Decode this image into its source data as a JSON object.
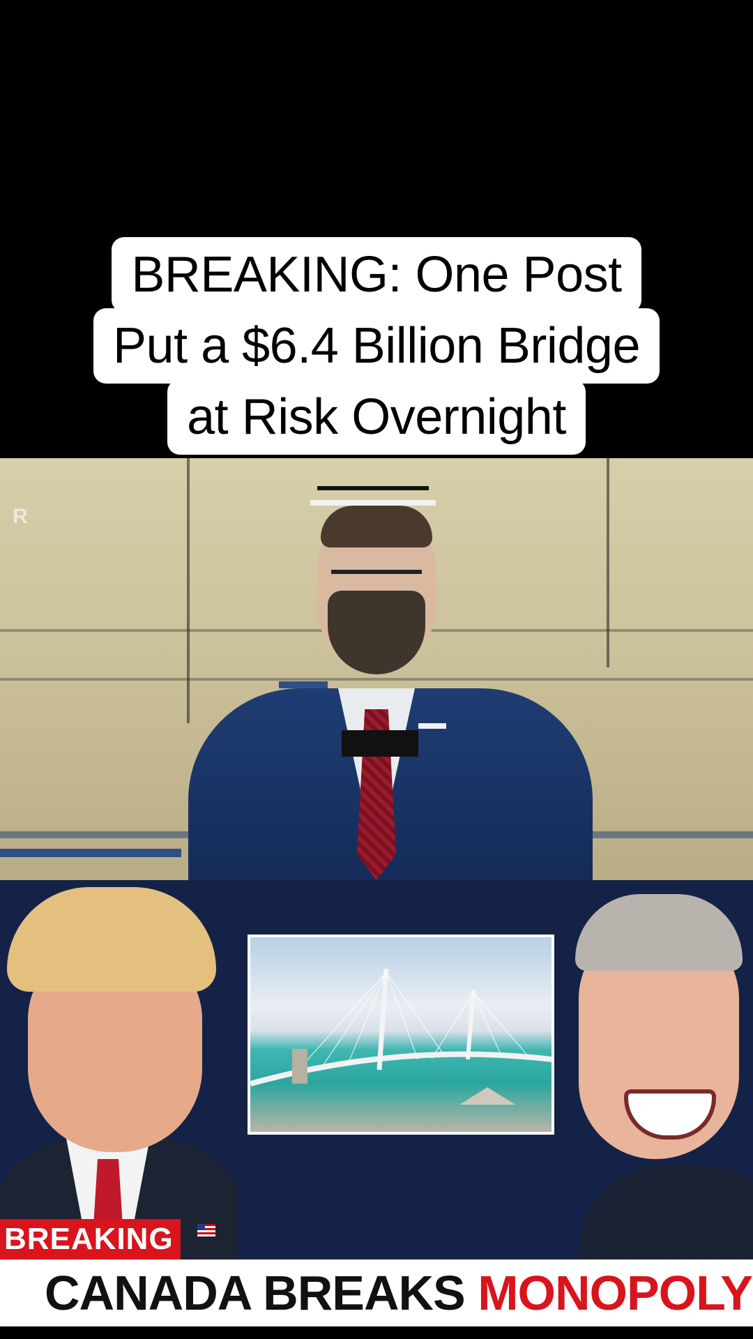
{
  "caption": {
    "lines": [
      "BREAKING: One Post",
      "Put a $6.4 Billion Bridge",
      "at Risk Overnight"
    ]
  },
  "video": {
    "watermark": "R"
  },
  "thumbnail": {
    "badge": "BREAKING",
    "headline_part1": "CANADA BREAKS",
    "headline_part2": "MONOPOLY"
  },
  "colors": {
    "badge_red": "#d8141c",
    "thumb_navy": "#142247"
  },
  "icons": [
    "us-flag-icon"
  ]
}
